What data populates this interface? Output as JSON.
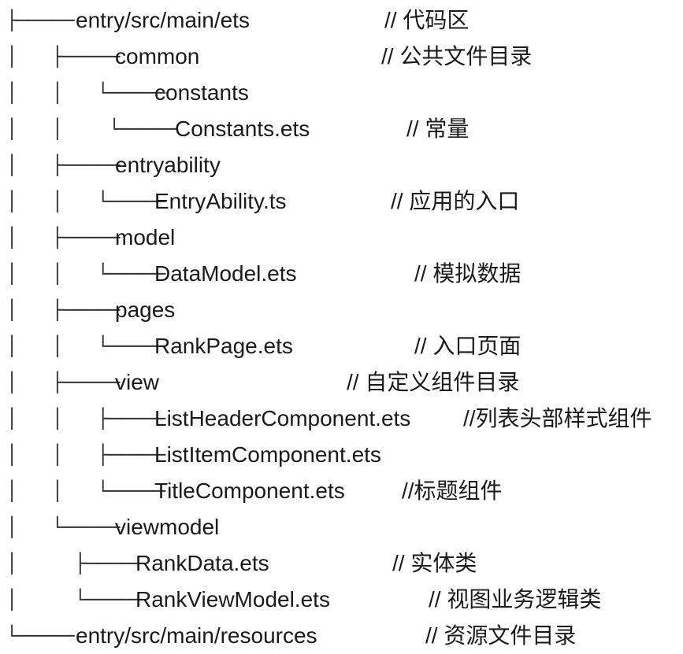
{
  "rows": [
    {
      "prefix": "├─────",
      "name": "entry/src/main/ets",
      "comment": "// 代码区"
    },
    {
      "prefix": "│   ├─────",
      "name": "common",
      "comment": "// 公共文件目录"
    },
    {
      "prefix": "│   │   └─────",
      "name": "constants",
      "comment": ""
    },
    {
      "prefix": "│   │    └─────",
      "name": "Constants.ets",
      "comment": "// 常量"
    },
    {
      "prefix": "│   ├─────",
      "name": "entryability",
      "comment": ""
    },
    {
      "prefix": "│   │   └─────",
      "name": "EntryAbility.ts",
      "comment": "// 应用的入口"
    },
    {
      "prefix": "│   ├─────",
      "name": "model",
      "comment": ""
    },
    {
      "prefix": "│   │   └─────",
      "name": "DataModel.ets",
      "comment": "// 模拟数据"
    },
    {
      "prefix": "│   ├─────",
      "name": "pages",
      "comment": ""
    },
    {
      "prefix": "│   │   └─────",
      "name": "RankPage.ets",
      "comment": "// 入口页面"
    },
    {
      "prefix": "│   ├─────",
      "name": "view",
      "comment": "// 自定义组件目录"
    },
    {
      "prefix": "│   │   ├─────",
      "name": "ListHeaderComponent.ets",
      "comment": "//列表头部样式组件"
    },
    {
      "prefix": "│   │   ├─────",
      "name": "ListItemComponent.ets",
      "comment": ""
    },
    {
      "prefix": "│   │   └─────",
      "name": "TitleComponent.ets",
      "comment": "//标题组件"
    },
    {
      "prefix": "│   └─────",
      "name": "viewmodel",
      "comment": ""
    },
    {
      "prefix": "│     ├─────",
      "name": "RankData.ets",
      "comment": "// 实体类"
    },
    {
      "prefix": "│     └─────",
      "name": "RankViewModel.ets",
      "comment": "// 视图业务逻辑类"
    },
    {
      "prefix": "└─────",
      "name": "entry/src/main/resources",
      "comment": "// 资源文件目录"
    }
  ]
}
